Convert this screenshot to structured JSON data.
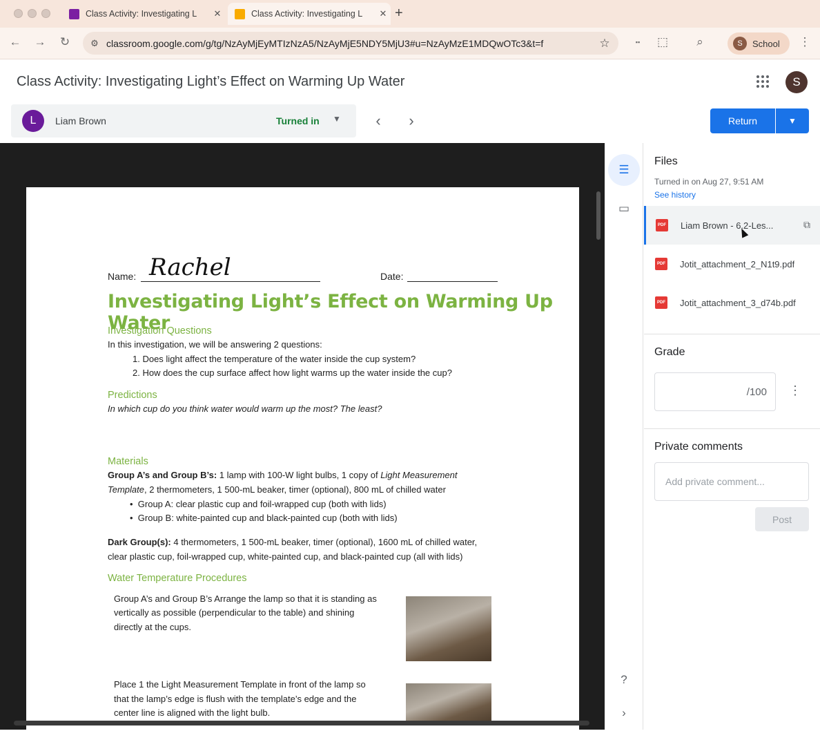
{
  "browser": {
    "tabs": [
      {
        "title": "Class Activity: Investigating L",
        "favicon_color": "#7b1fa2"
      },
      {
        "title": "Class Activity: Investigating L",
        "favicon_color": "#f9ab00"
      }
    ],
    "url": "classroom.google.com/g/tg/NzAyMjEyMTIzNzA5/NzAyMjE5NDY5MjU3#u=NzAyMzE1MDQwOTc3&t=f",
    "profile": {
      "initial": "S",
      "label": "School"
    }
  },
  "header": {
    "title": "Class Activity: Investigating Light’s Effect on Warming Up Water",
    "user_initial": "S"
  },
  "student": {
    "initial": "L",
    "name": "Liam Brown",
    "status": "Turned in"
  },
  "actions": {
    "return_label": "Return"
  },
  "document": {
    "name_label": "Name:",
    "signature": "Rachel",
    "date_label": "Date:",
    "title": "Investigating Light’s Effect on Warming Up Water",
    "investigation_heading": "Investigation Questions",
    "investigation_intro": "In this investigation, we will be answering 2 questions:",
    "questions": [
      "1. Does light affect the temperature of the water inside the cup system?",
      "2. How does the cup surface affect how light warms up the water inside the cup?"
    ],
    "predictions_heading": "Predictions",
    "predictions_text": "In which cup do you think water would warm up the most? The least?",
    "materials_heading": "Materials",
    "materials_groups_bold": "Group A’s and Group B’s:",
    "materials_groups_text1": " 1 lamp with 100-W light bulbs, 1 copy of ",
    "materials_groups_ital": "Light Measurement",
    "materials_groups_ital2": "Template",
    "materials_groups_text2": ", 2 thermometers, 1 500-mL beaker, timer (optional), 800 mL of chilled water",
    "bullets": [
      "Group A: clear plastic cup and foil-wrapped cup (both with lids)",
      "Group B: white-painted cup and black-painted cup (both with lids)"
    ],
    "dark_bold": "Dark Group(s):",
    "dark_text1": " 4 thermometers, 1 500-mL beaker, timer (optional), 1600 mL of chilled water,",
    "dark_text2": "clear plastic cup, foil-wrapped cup, white-painted cup, and black-painted cup (all with lids)",
    "procedures_heading": "Water Temperature Procedures",
    "step1": [
      "Group A’s and Group B’s Arrange the lamp so that it is standing as",
      "vertically as possible (perpendicular to the table) and shining",
      "directly at the cups."
    ],
    "step2": [
      "Place 1 the Light Measurement Template in front of the lamp so",
      "that the lamp’s edge is flush with the template’s edge and the",
      "center line is aligned with the light bulb."
    ]
  },
  "panel": {
    "files_heading": "Files",
    "turned_in_meta": "Turned in on Aug 27, 9:51 AM",
    "see_history": "See history",
    "files": [
      "Liam Brown - 6.2-Les...",
      "Jotit_attachment_2_N1t9.pdf",
      "Jotit_attachment_3_d74b.pdf"
    ],
    "pdf_badge": "PDF",
    "grade_heading": "Grade",
    "grade_denominator": "/100",
    "comments_heading": "Private comments",
    "comment_placeholder": "Add private comment...",
    "post_label": "Post"
  },
  "colors": {
    "accent": "#1a73e8",
    "status_green": "#188038",
    "doc_heading_green": "#7cb342"
  }
}
